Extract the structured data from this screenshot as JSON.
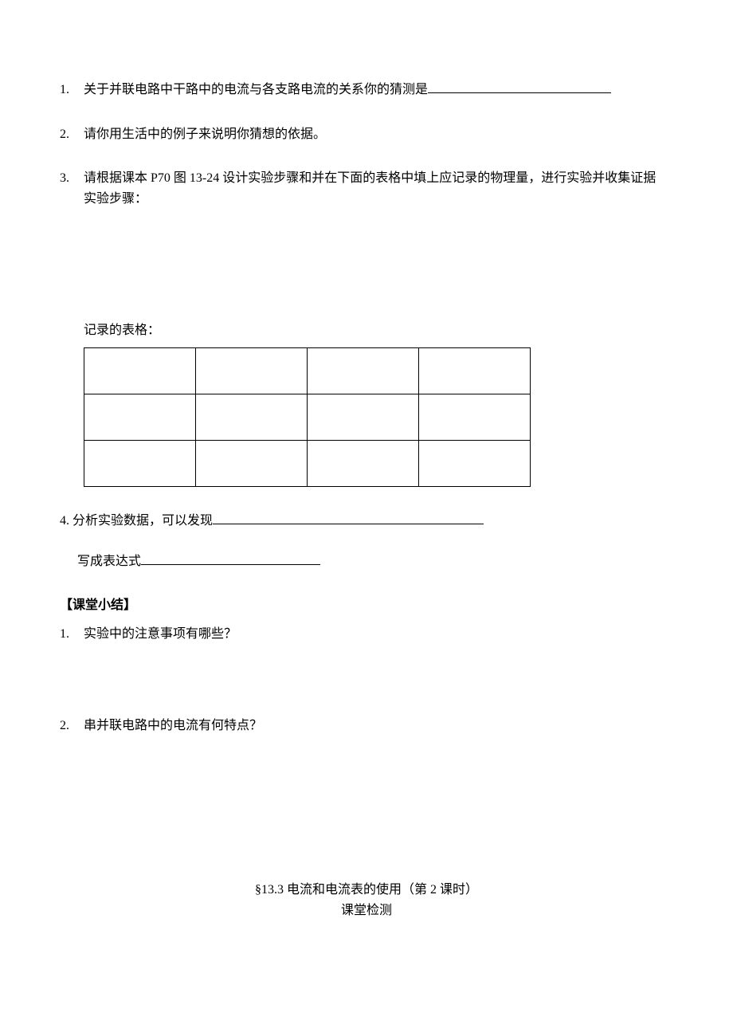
{
  "items": {
    "n1": "1.",
    "q1": "关于并联电路中干路中的电流与各支路电流的关系你的猜测是",
    "n2": "2.",
    "q2": "请你用生活中的例子来说明你猜想的依据。",
    "n3": "3.",
    "q3_l1": "请根据课本 P70 图 13-24 设计实验步骤和并在下面的表格中填上应记录的物理量，进行实验并收集证据",
    "q3_l2": "实验步骤：",
    "table_label": "记录的表格：",
    "q4_prefix": "4. 分析实验数据，可以发现",
    "expr_prefix": "写成表达式"
  },
  "summary": {
    "heading": "【课堂小结】",
    "n1": "1.",
    "q1": "实验中的注意事项有哪些？",
    "n2": "2.",
    "q2": "串并联电路中的电流有何特点？"
  },
  "footer": {
    "title": "§13.3 电流和电流表的使用（第 2 课时）",
    "subtitle": "课堂检测"
  }
}
